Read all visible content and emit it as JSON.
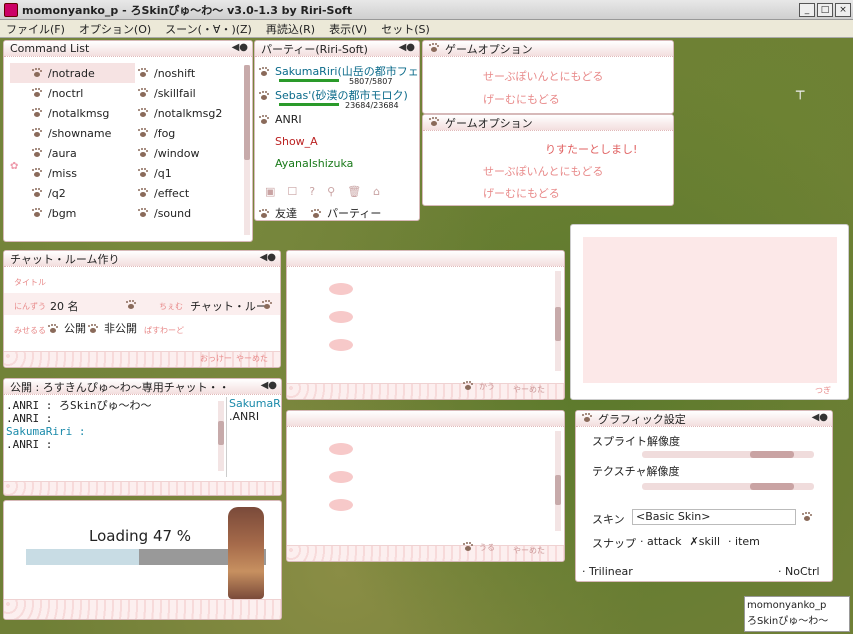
{
  "titlebar": {
    "title": "momonyanko_p - ろSkinぴゅ〜わ〜 v3.0-1.3 by Riri-Soft"
  },
  "menu": [
    "ファイル(F)",
    "オプション(O)",
    "スーン(・∀・)(Z)",
    "再読込(R)",
    "表示(V)",
    "セット(S)"
  ],
  "command_list": {
    "title": "Command List",
    "left": [
      "/notrade",
      "/noctrl",
      "/notalkmsg",
      "/showname",
      "/aura",
      "/miss",
      "/q2",
      "/bgm"
    ],
    "right": [
      "/noshift",
      "/skillfail",
      "/notalkmsg2",
      "/fog",
      "/window",
      "/q1",
      "/effect",
      "/sound"
    ]
  },
  "party": {
    "title": "パーティー(Riri-Soft)",
    "members": [
      {
        "name": "SakumaRiri(山岳の都市フェ",
        "hp": "5807/5807"
      },
      {
        "name": "Sebas'(砂漠の都市モロク)",
        "hp": "23684/23684"
      },
      {
        "name": "ANRI"
      },
      {
        "name": "Show_A"
      },
      {
        "name": "AyanaIshizuka"
      }
    ],
    "tab_friends": "友達",
    "tab_party": "パーティー"
  },
  "game_option1": {
    "title": "ゲームオプション",
    "items": [
      "せーぶぽいんとにもどる",
      "げーむにもどる"
    ]
  },
  "game_option2": {
    "title": "ゲームオプション",
    "items": [
      "りすたーとしまし!",
      "せーぶぽいんとにもどる",
      "げーむにもどる"
    ]
  },
  "chat_room": {
    "title": "チャット・ルーム作り",
    "title_label": "タイトル",
    "people_label": "にんずう",
    "people": "20 名",
    "type_label": "ちぇむ",
    "type_value": "チャット・ルー",
    "visibility_label": "みせるる",
    "public": "公開",
    "private": "非公開",
    "password_label": "ぱすわーど",
    "ok": "おっけー",
    "cancel": "やーめた"
  },
  "mid_window": {
    "ok": "かう",
    "cancel": "やーめた"
  },
  "mid_window2": {
    "ok": "うる",
    "cancel": "やーめた"
  },
  "right_box": {
    "next": "つぎ"
  },
  "chat": {
    "title": "公開 : ろすきんぴゅ〜わ〜専用チャット・・",
    "lines": [
      ".ANRI : ろSkinぴゅ〜わ〜",
      ".ANRI :",
      "SakumaRiri :",
      ".ANRI :"
    ],
    "names": [
      "SakumaRiri",
      ".ANRI"
    ]
  },
  "loading": {
    "text": "Loading 47 %",
    "progress": 0.47
  },
  "graphic": {
    "title": "グラフィック設定",
    "sprite_label": "スプライト解像度",
    "texture_label": "テクスチャ解像度",
    "skin_label": "スキン",
    "skin_value": "<Basic Skin>",
    "snap_label": "スナップ",
    "snap_attack": "attack",
    "snap_skill": "skill",
    "snap_item": "item",
    "trilinear": "Trilinear",
    "noctrl": "NoCtrl"
  },
  "status": {
    "user": "momonyanko_p",
    "skin": "ろSkinぴゅ〜わ〜"
  }
}
